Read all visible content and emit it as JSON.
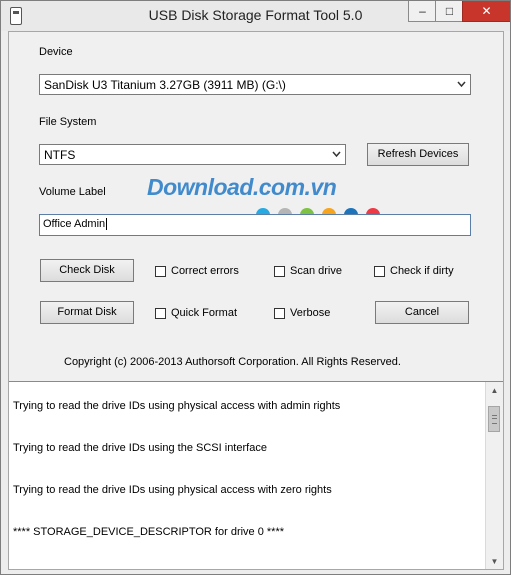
{
  "window": {
    "title": "USB Disk Storage Format Tool 5.0",
    "minimize_glyph": "–",
    "maximize_glyph": "□",
    "close_glyph": "✕"
  },
  "device": {
    "label": "Device",
    "selected": "SanDisk U3 Titanium 3.27GB (3911 MB)  (G:\\)"
  },
  "file_system": {
    "label": "File System",
    "selected": "NTFS"
  },
  "refresh_label": "Refresh Devices",
  "volume_label": {
    "label": "Volume Label",
    "value": "Office Admin"
  },
  "buttons": {
    "check_disk": "Check Disk",
    "format_disk": "Format Disk",
    "cancel": "Cancel"
  },
  "options": {
    "correct_errors": "Correct errors",
    "scan_drive": "Scan drive",
    "check_if_dirty": "Check if dirty",
    "quick_format": "Quick Format",
    "verbose": "Verbose"
  },
  "copyright": "Copyright (c) 2006-2013 Authorsoft Corporation. All Rights Reserved.",
  "log": {
    "lines": [
      "Trying to read the drive IDs using physical access with admin rights",
      "Trying to read the drive IDs using the SCSI interface",
      "Trying to read the drive IDs using physical access with zero rights",
      "**** STORAGE_DEVICE_DESCRIPTOR for drive 0 ****"
    ]
  },
  "watermark": {
    "text": "Download.com.vn",
    "dot_colors": [
      "#27a9e1",
      "#b5b5b5",
      "#7dc242",
      "#f7a51c",
      "#1d74bb",
      "#ed3a45"
    ]
  },
  "icons": {
    "app": "usb-drive-icon",
    "dropdown": "chevron-down-icon",
    "scroll_up": "scroll-up-arrow-icon",
    "scroll_down": "scroll-down-arrow-icon"
  },
  "colors": {
    "close_button": "#c7352b",
    "watermark": "#2f80c9"
  }
}
